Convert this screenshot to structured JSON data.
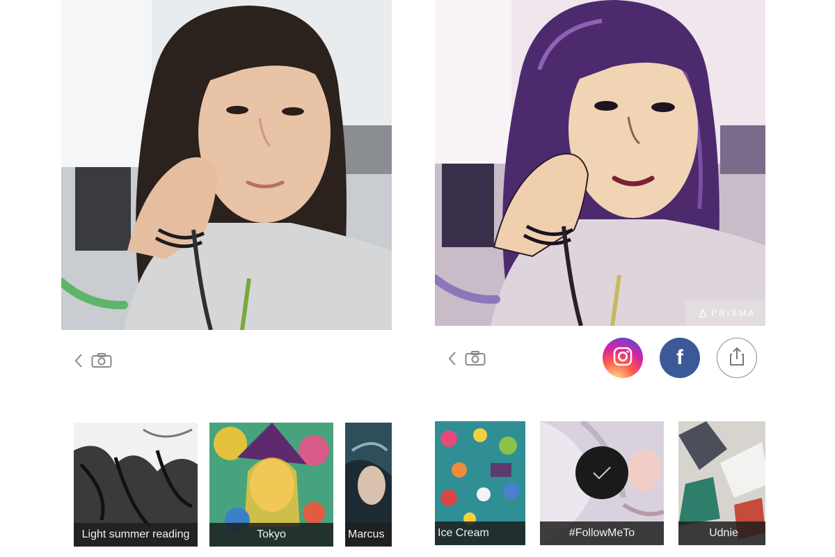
{
  "colors": {
    "instagram_gradient": [
      "#fdf497",
      "#fd5949",
      "#d6249f",
      "#285AEB"
    ],
    "facebook": "#3b5998",
    "label_background": "#1e1e1e",
    "background": "#ffffff"
  },
  "left_screen": {
    "toolbar": {
      "back_icon": "chevron-left-icon",
      "camera_icon": "camera-icon"
    },
    "filters": [
      {
        "label": "Light summer reading",
        "selected": false
      },
      {
        "label": "Tokyo",
        "selected": false
      },
      {
        "label": "Marcus",
        "selected": false
      }
    ]
  },
  "right_screen": {
    "watermark": "PRISMA",
    "toolbar": {
      "back_icon": "chevron-left-icon",
      "camera_icon": "camera-icon",
      "share_buttons": [
        {
          "name": "instagram",
          "icon": "instagram-icon"
        },
        {
          "name": "facebook",
          "icon": "facebook-icon",
          "glyph": "f"
        },
        {
          "name": "share",
          "icon": "share-icon"
        }
      ]
    },
    "filters": [
      {
        "label": "Ice Cream",
        "selected": false
      },
      {
        "label": "#FollowMeTo",
        "selected": true
      },
      {
        "label": "Udnie",
        "selected": false
      }
    ]
  }
}
